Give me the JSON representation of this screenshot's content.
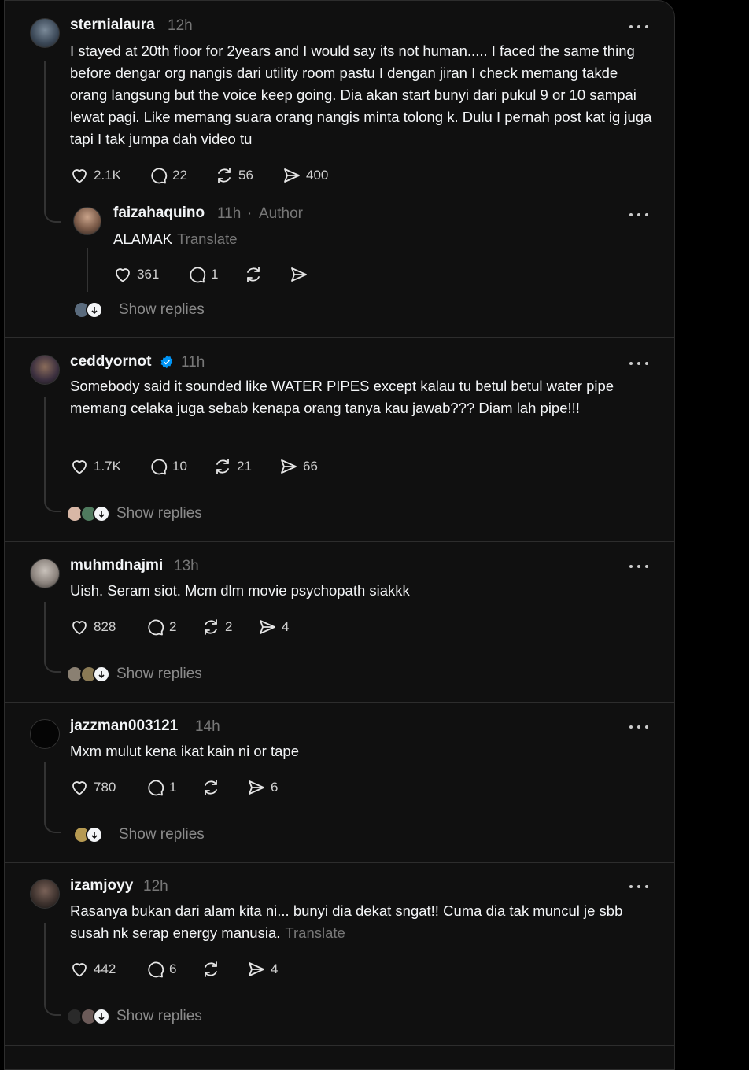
{
  "posts": [
    {
      "username": "sternialaura",
      "time": "12h",
      "text": "I stayed at 20th floor for 2years and I would say its not human..... I faced the same thing before dengar org nangis dari utility room pastu I dengan jiran I check memang takde orang langsung but the voice keep going. Dia akan start bunyi dari pukul 9 or 10 sampai lewat pagi. Like memang suara orang nangis minta tolong k. Dulu I pernah post kat ig juga tapi I tak jumpa dah video tu",
      "likes": "2.1K",
      "comments": "22",
      "reposts": "56",
      "shares": "400",
      "reply": {
        "username": "faizahaquino",
        "time": "11h",
        "author_tag": "Author",
        "separator": "·",
        "text": "ALAMAK",
        "translate": "Translate",
        "likes": "361",
        "comments": "1",
        "reposts": "",
        "shares": ""
      },
      "show_replies": "Show replies"
    },
    {
      "username": "ceddyornot",
      "time": "11h",
      "text": "Somebody said it sounded like WATER PIPES except kalau tu betul betul water pipe memang celaka juga sebab kenapa orang tanya kau jawab??? Diam lah pipe!!!",
      "likes": "1.7K",
      "comments": "10",
      "reposts": "21",
      "shares": "66",
      "show_replies": "Show replies"
    },
    {
      "username": "muhmdnajmi",
      "time": "13h",
      "text": "Uish. Seram siot. Mcm dlm movie psychopath siakkk",
      "likes": "828",
      "comments": "2",
      "reposts": "2",
      "shares": "4",
      "show_replies": "Show replies"
    },
    {
      "username": "jazzman003121",
      "time": "14h",
      "text": "Mxm mulut kena ikat kain ni or tape",
      "likes": "780",
      "comments": "1",
      "reposts": "",
      "shares": "6",
      "show_replies": "Show replies"
    },
    {
      "username": "izamjoyy",
      "time": "12h",
      "text": "Rasanya bukan dari alam kita ni... bunyi dia dekat sngat!! Cuma dia tak muncul je sbb susah nk serap energy manusia.",
      "translate": "Translate",
      "likes": "442",
      "comments": "6",
      "reposts": "",
      "shares": "4",
      "show_replies": "Show replies"
    }
  ],
  "colors": {
    "background": "#101010",
    "text": "#f3f5f7",
    "muted": "#777777",
    "verified": "#0095f6",
    "divider": "#2d2d2d"
  },
  "icons": [
    "heart-icon",
    "comment-icon",
    "repost-icon",
    "share-icon",
    "more-icon",
    "verified-badge-icon",
    "arrow-down-icon"
  ]
}
